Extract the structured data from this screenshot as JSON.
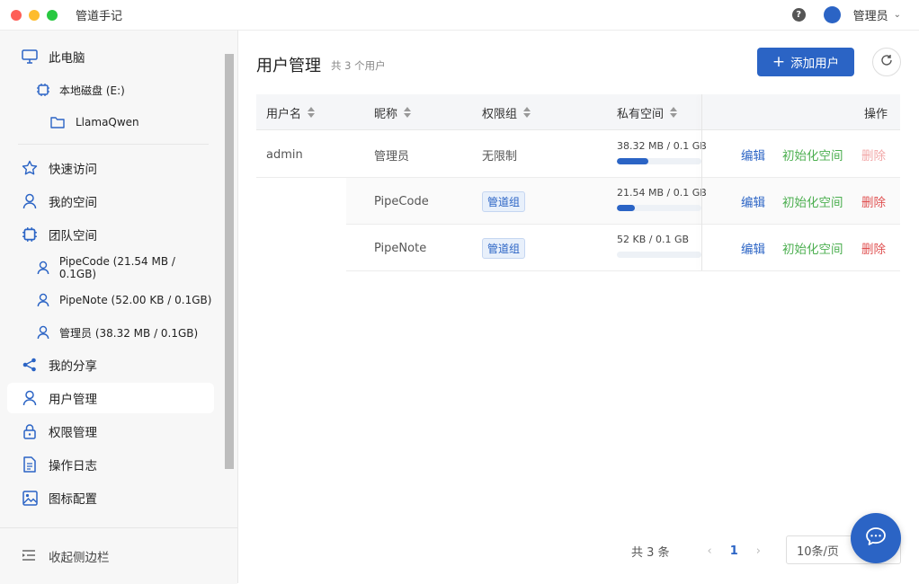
{
  "window": {
    "title": "管道手记"
  },
  "topbar": {
    "help_icon": "question-circle-icon",
    "user_name": "管理员"
  },
  "sidebar": {
    "items": [
      {
        "label": "此电脑",
        "icon": "monitor-icon"
      },
      {
        "label": "本地磁盘 (E:)",
        "icon": "chip-icon"
      },
      {
        "label": "LlamaQwen",
        "icon": "folder-icon"
      },
      {
        "label": "快速访问",
        "icon": "star-icon"
      },
      {
        "label": "我的空间",
        "icon": "user-icon"
      },
      {
        "label": "团队空间",
        "icon": "chip-icon"
      },
      {
        "label": "PipeCode (21.54 MB / 0.1GB)",
        "icon": "user-icon"
      },
      {
        "label": "PipeNote (52.00 KB / 0.1GB)",
        "icon": "user-icon"
      },
      {
        "label": "管理员 (38.32 MB / 0.1GB)",
        "icon": "user-icon"
      },
      {
        "label": "我的分享",
        "icon": "share-icon"
      },
      {
        "label": "用户管理",
        "icon": "user-icon"
      },
      {
        "label": "权限管理",
        "icon": "lock-icon"
      },
      {
        "label": "操作日志",
        "icon": "document-icon"
      },
      {
        "label": "图标配置",
        "icon": "image-icon"
      }
    ],
    "collapse_label": "收起侧边栏"
  },
  "main": {
    "title": "用户管理",
    "count_text": "共 3 个用户",
    "add_button": "添加用户",
    "columns": [
      "用户名",
      "昵称",
      "权限组",
      "私有空间",
      "操作"
    ],
    "rows": [
      {
        "username": "admin",
        "nickname": "管理员",
        "group": "无限制",
        "group_is_tag": false,
        "quota_text": "38.32 MB / 0.1 GB",
        "quota_fraction": 0.37,
        "edit": "编辑",
        "init": "初始化空间",
        "delete": "删除",
        "delete_disabled": true
      },
      {
        "username": "",
        "nickname": "PipeCode",
        "group": "管道组",
        "group_is_tag": true,
        "quota_text": "21.54 MB / 0.1 GB",
        "quota_fraction": 0.21,
        "edit": "编辑",
        "init": "初始化空间",
        "delete": "删除",
        "delete_disabled": false
      },
      {
        "username": "",
        "nickname": "PipeNote",
        "group": "管道组",
        "group_is_tag": true,
        "quota_text": "52 KB / 0.1 GB",
        "quota_fraction": 0.0,
        "edit": "编辑",
        "init": "初始化空间",
        "delete": "删除",
        "delete_disabled": false
      }
    ]
  },
  "pagination": {
    "total_text": "共 3 条",
    "current_page": "1",
    "page_size": "10条/页"
  },
  "colors": {
    "accent": "#2b64c5",
    "init_green": "#4caf50",
    "delete_red": "#e05252"
  }
}
